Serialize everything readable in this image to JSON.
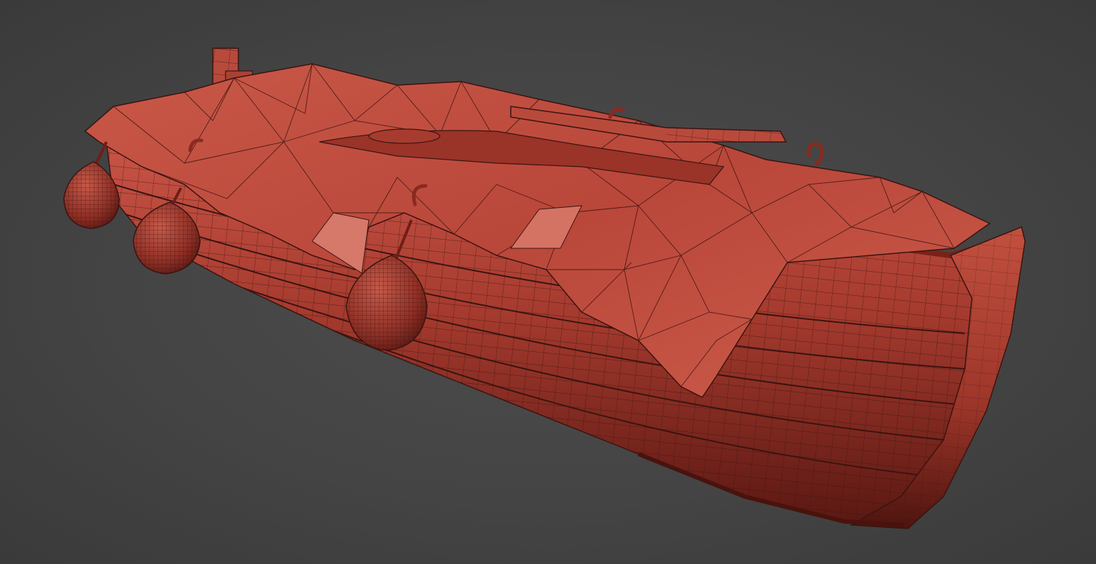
{
  "viewport": {
    "background_color": "#454545",
    "model": {
      "subject": "rowboat-with-tarp",
      "shading": "wireframe-on-shaded",
      "base_color": "#b84a3c",
      "wire_color": "#3a1410",
      "fender_count": 3,
      "oar_count": 1,
      "hook_count": 4
    }
  }
}
